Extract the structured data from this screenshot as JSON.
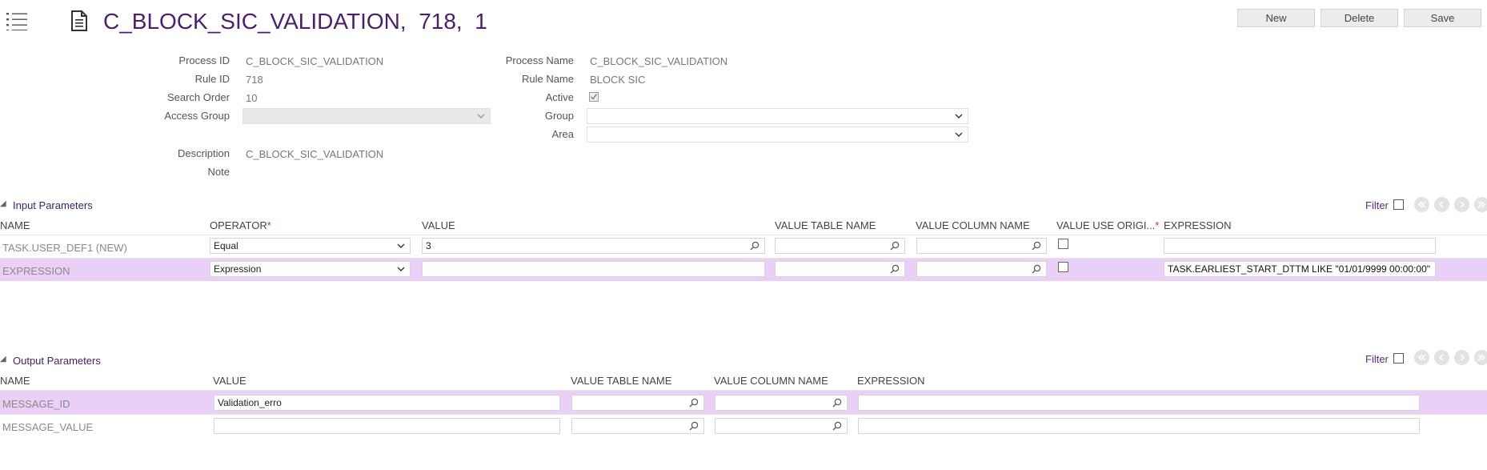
{
  "header": {
    "title": "C_BLOCK_SIC_VALIDATION,  718,  1",
    "buttons": {
      "new": "New",
      "delete": "Delete",
      "save": "Save"
    }
  },
  "form": {
    "process_id_label": "Process ID",
    "process_id": "C_BLOCK_SIC_VALIDATION",
    "rule_id_label": "Rule ID",
    "rule_id": "718",
    "search_order_label": "Search Order",
    "search_order": "10",
    "access_group_label": "Access Group",
    "access_group": "",
    "description_label": "Description",
    "description": "C_BLOCK_SIC_VALIDATION",
    "note_label": "Note",
    "note": "",
    "process_name_label": "Process Name",
    "process_name": "C_BLOCK_SIC_VALIDATION",
    "rule_name_label": "Rule Name",
    "rule_name": "BLOCK SIC",
    "active_label": "Active",
    "active": true,
    "group_label": "Group",
    "group": "",
    "area_label": "Area",
    "area": ""
  },
  "input_params": {
    "title": "Input Parameters",
    "filter": "Filter",
    "columns": {
      "name": "NAME",
      "operator": "OPERATOR",
      "value": "VALUE",
      "value_table_name": "VALUE TABLE NAME",
      "value_column_name": "VALUE COLUMN NAME",
      "value_use_orig": "VALUE USE ORIGI...",
      "expression": "EXPRESSION",
      "required_mark": "*"
    },
    "rows": [
      {
        "name": "TASK.USER_DEF1 (NEW)",
        "operator": "Equal",
        "value": "3",
        "value_table_name": "",
        "value_column_name": "",
        "use_orig": false,
        "expression": ""
      },
      {
        "name": "EXPRESSION",
        "operator": "Expression",
        "value": "",
        "value_table_name": "",
        "value_column_name": "",
        "use_orig": false,
        "expression": "TASK.EARLIEST_START_DTTM LIKE \"01/01/9999 00:00:00\""
      }
    ]
  },
  "output_params": {
    "title": "Output Parameters",
    "filter": "Filter",
    "columns": {
      "name": "NAME",
      "value": "VALUE",
      "value_table_name": "VALUE TABLE NAME",
      "value_column_name": "VALUE COLUMN NAME",
      "expression": "EXPRESSION"
    },
    "rows": [
      {
        "name": "MESSAGE_ID",
        "value": "Validation_erro",
        "value_table_name": "",
        "value_column_name": "",
        "expression": ""
      },
      {
        "name": "MESSAGE_VALUE",
        "value": "",
        "value_table_name": "",
        "value_column_name": "",
        "expression": ""
      }
    ]
  },
  "colors": {
    "accent": "#4b1e6e",
    "selected_row": "#eacff6",
    "link": "#5a2d8c"
  }
}
